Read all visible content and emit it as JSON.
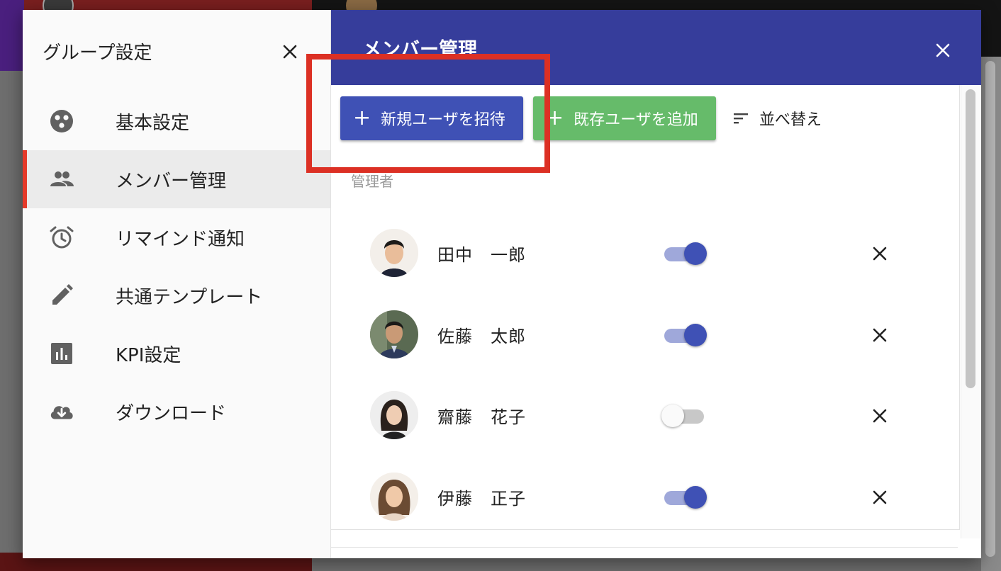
{
  "colors": {
    "header": "#363d9b",
    "primary": "#3f51b5",
    "success": "#66bb6a",
    "active_marker": "#e53a2a",
    "highlight": "#dc3024"
  },
  "settings_panel": {
    "title": "グループ設定",
    "close_icon": "close-icon",
    "items": [
      {
        "label": "基本設定",
        "icon": "palette-icon",
        "active": false
      },
      {
        "label": "メンバー管理",
        "icon": "people-icon",
        "active": true
      },
      {
        "label": "リマインド通知",
        "icon": "alarm-icon",
        "active": false
      },
      {
        "label": "共通テンプレート",
        "icon": "pencil-icon",
        "active": false
      },
      {
        "label": "KPI設定",
        "icon": "bar-chart-icon",
        "active": false
      },
      {
        "label": "ダウンロード",
        "icon": "cloud-download-icon",
        "active": false
      }
    ]
  },
  "member_panel": {
    "title": "メンバー管理",
    "close_icon": "close-icon",
    "toolbar": {
      "invite_label": "新規ユーザを招待",
      "add_existing_label": "既存ユーザを追加",
      "sort_label": "並べ替え"
    },
    "section_label": "管理者",
    "members": [
      {
        "name": "田中　一郎",
        "enabled": true
      },
      {
        "name": "佐藤　太郎",
        "enabled": true
      },
      {
        "name": "齋藤　花子",
        "enabled": false
      },
      {
        "name": "伊藤　正子",
        "enabled": true
      }
    ]
  }
}
